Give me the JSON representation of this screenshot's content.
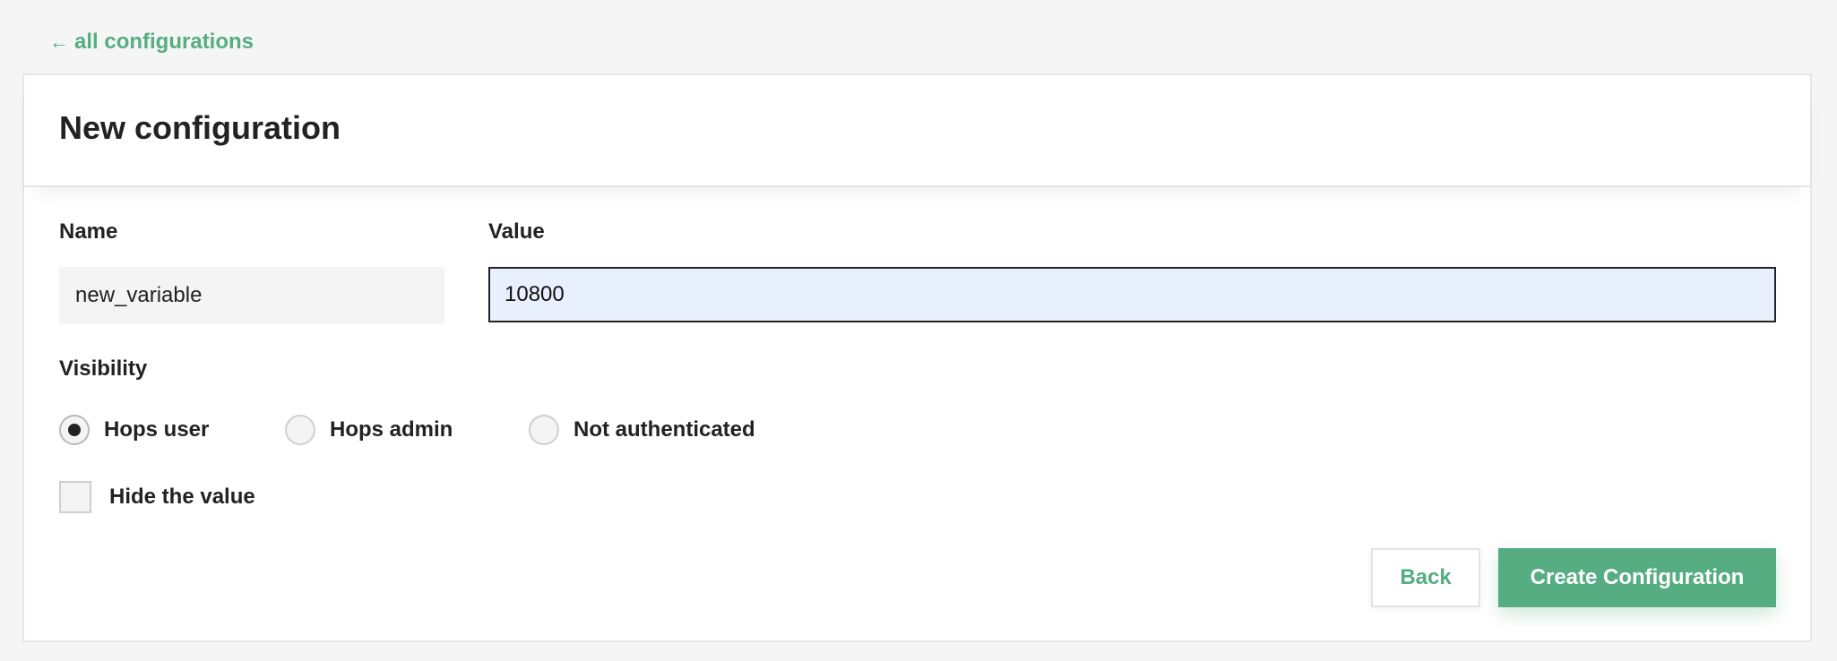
{
  "nav": {
    "back_arrow": "←",
    "back_link_label": "all configurations"
  },
  "card": {
    "title": "New configuration"
  },
  "form": {
    "name_label": "Name",
    "name_value": "new_variable",
    "value_label": "Value",
    "value_value": "10800",
    "visibility_label": "Visibility",
    "visibility_options": [
      {
        "label": "Hops user",
        "selected": true
      },
      {
        "label": "Hops admin",
        "selected": false
      },
      {
        "label": "Not authenticated",
        "selected": false
      }
    ],
    "hide_value_label": "Hide the value",
    "hide_value_checked": false
  },
  "actions": {
    "back_label": "Back",
    "create_label": "Create Configuration"
  },
  "colors": {
    "accent": "#56ad82",
    "page_background": "#f5f5f5",
    "input_autofill": "#e8f0fe"
  }
}
